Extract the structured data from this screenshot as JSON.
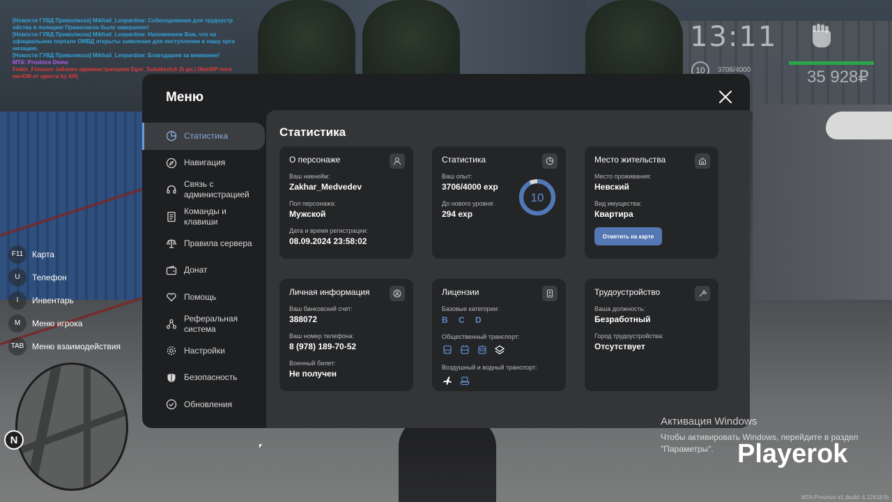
{
  "chat": [
    {
      "text": "[Новости ГУВД Приволжска] Mikhail_Leopardow: Собеседование для трудоустр ойства в полицию Приволжска было завершено!",
      "color": "#34a3d9"
    },
    {
      "text": "[Новости ГУВД Приволжска] Mikhail_Leopardow: Напоминаем Вам, что на официальном портале ОМВД открыты заявление для поступления в нашу орга низацию.",
      "color": "#34a3d9"
    },
    {
      "text": "[Новости ГУВД Приволжска] Mikhail_Leopardow: Благодарим за внимание!",
      "color": "#34a3d9"
    },
    {
      "text": "MTA: Province Demo",
      "color": "#b25fe6"
    },
    {
      "text": "Fedor_Fimozov забанен администратором Egor_Sobakevich (5 дн.) (NonRP поги ни+DM от ареста by AR)",
      "color": "#e23b3b"
    }
  ],
  "hud": {
    "time": "13:11",
    "level": "10",
    "exp": "3706/4000",
    "money": "35 928₽"
  },
  "hotkeys": [
    {
      "key": "F11",
      "label": "Карта"
    },
    {
      "key": "U",
      "label": "Телефон"
    },
    {
      "key": "I",
      "label": "Инвентарь"
    },
    {
      "key": "M",
      "label": "Меню игрока"
    },
    {
      "key": "TAB",
      "label": "Меню взаимодействия"
    }
  ],
  "minimap": {
    "north": "N"
  },
  "menu": {
    "title": "Меню",
    "nav": [
      {
        "label": "Статистика",
        "icon": "pie-chart-icon"
      },
      {
        "label": "Навигация",
        "icon": "compass-icon"
      },
      {
        "label": "Связь с администрацией",
        "icon": "headset-icon"
      },
      {
        "label": "Команды и клавиши",
        "icon": "document-icon"
      },
      {
        "label": "Правила сервера",
        "icon": "scales-icon"
      },
      {
        "label": "Донат",
        "icon": "wallet-icon"
      },
      {
        "label": "Помощь",
        "icon": "heart-hand-icon"
      },
      {
        "label": "Реферальная система",
        "icon": "network-icon"
      },
      {
        "label": "Настройки",
        "icon": "gear-icon"
      },
      {
        "label": "Безопасность",
        "icon": "shield-icon"
      },
      {
        "label": "Обновления",
        "icon": "check-circle-icon"
      }
    ],
    "content_title": "Статистика"
  },
  "cards": {
    "character": {
      "title": "О персонаже",
      "nickname_label": "Ваш никнейм:",
      "nickname": "Zakhar_Medvedev",
      "gender_label": "Пол персонажа:",
      "gender": "Мужской",
      "reg_label": "Дата и время регистрации:",
      "reg": "08.09.2024 23:58:02"
    },
    "stats": {
      "title": "Статистика",
      "exp_label": "Ваш опыт:",
      "exp": "3706/4000 exp",
      "next_label": "До нового уровня:",
      "next": "294 exp",
      "level": "10",
      "progress": 0.9265
    },
    "residence": {
      "title": "Место жительства",
      "place_label": "Место проживания:",
      "place": "Невский",
      "type_label": "Вид имущества:",
      "type": "Квартира",
      "button": "Отметить на карте"
    },
    "personal": {
      "title": "Личная информация",
      "bank_label": "Ваш банковский счет:",
      "bank": "388072",
      "phone_label": "Ваш номер телефона:",
      "phone": "8 (978) 189-70-52",
      "military_label": "Военный билет:",
      "military": "Не получен"
    },
    "licenses": {
      "title": "Лицензии",
      "base_label": "Базовые категории:",
      "base": "B C D",
      "public_label": "Общественный транспорт:",
      "air_label": "Воздушный и водный транспорт:"
    },
    "job": {
      "title": "Трудоустройство",
      "position_label": "Ваша должность:",
      "position": "Безработный",
      "city_label": "Город трудоустройства:",
      "city": "Отсутствует"
    }
  },
  "activation": {
    "title": "Активация Windows",
    "text1": "Чтобы активировать Windows, перейдите в раздел",
    "text2": "\"Параметры\"."
  },
  "watermark": "Playerok",
  "build": "MTA:Province #1 (build: 6.12418.9)",
  "colors": {
    "accent": "#6f9be0",
    "button": "#5577b3",
    "license": "#5e8ccc"
  }
}
